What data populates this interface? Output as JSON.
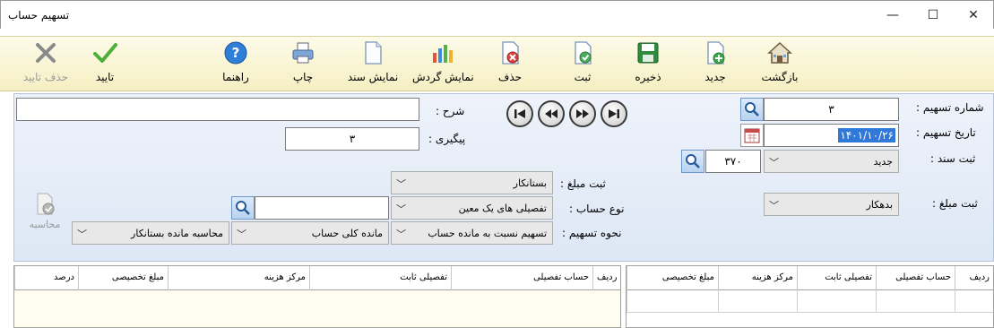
{
  "window": {
    "title": "تسهیم حساب",
    "min": "—",
    "max": "☐",
    "close": "✕"
  },
  "toolbar": {
    "back": "بازگشت",
    "new": "جدید",
    "save": "ذخیره",
    "register": "ثبت",
    "delete": "حذف",
    "show_flow": "نمایش گردش",
    "show_doc": "نمایش سند",
    "print": "چاپ",
    "help": "راهنما",
    "confirm": "تایید",
    "delete_confirm": "حذف تایید"
  },
  "form": {
    "distribution_number_label": "شماره تسهیم :",
    "distribution_number": "۳",
    "distribution_date_label": "تاریخ تسهیم :",
    "distribution_date": "۱۴۰۱/۱۰/۲۶",
    "doc_register_label": "ثبت سند :",
    "doc_register_value": "جدید",
    "doc_number": "۳۷۰",
    "amount_label_right": "ثبت مبلغ :",
    "amount_right_value": "بدهکار",
    "description_label": "شرح :",
    "description": "",
    "followup_label": "پیگیری :",
    "followup": "۳",
    "amount_label_mid": "ثبت مبلغ :",
    "amount_mid_value": "بستانکار",
    "account_type_label": "نوع حساب :",
    "account_type_value": "تفصیلی های یک معین",
    "account_search": "",
    "method_label": "نحوه تسهیم :",
    "method_value": "تسهیم نسبت به مانده حساب",
    "balance_type_value": "مانده کلی حساب",
    "calc_mode_value": "محاسبه مانده بستانکار",
    "calculate_label": "محاسبه"
  },
  "grid_right": {
    "headers": [
      "ردیف",
      "حساب تفصیلی",
      "تفصیلی ثابت",
      "مرکز هزینه",
      "مبلغ تخصیصی"
    ]
  },
  "grid_left": {
    "headers": [
      "ردیف",
      "حساب تفصیلی",
      "تفصیلی ثابت",
      "مرکز هزینه",
      "مبلغ تخصیصی",
      "درصد"
    ]
  },
  "colors": {
    "toolbar_bg": "#f6efc3",
    "panel_bg": "#dde7f5",
    "grid_bg": "#fffdf0"
  }
}
